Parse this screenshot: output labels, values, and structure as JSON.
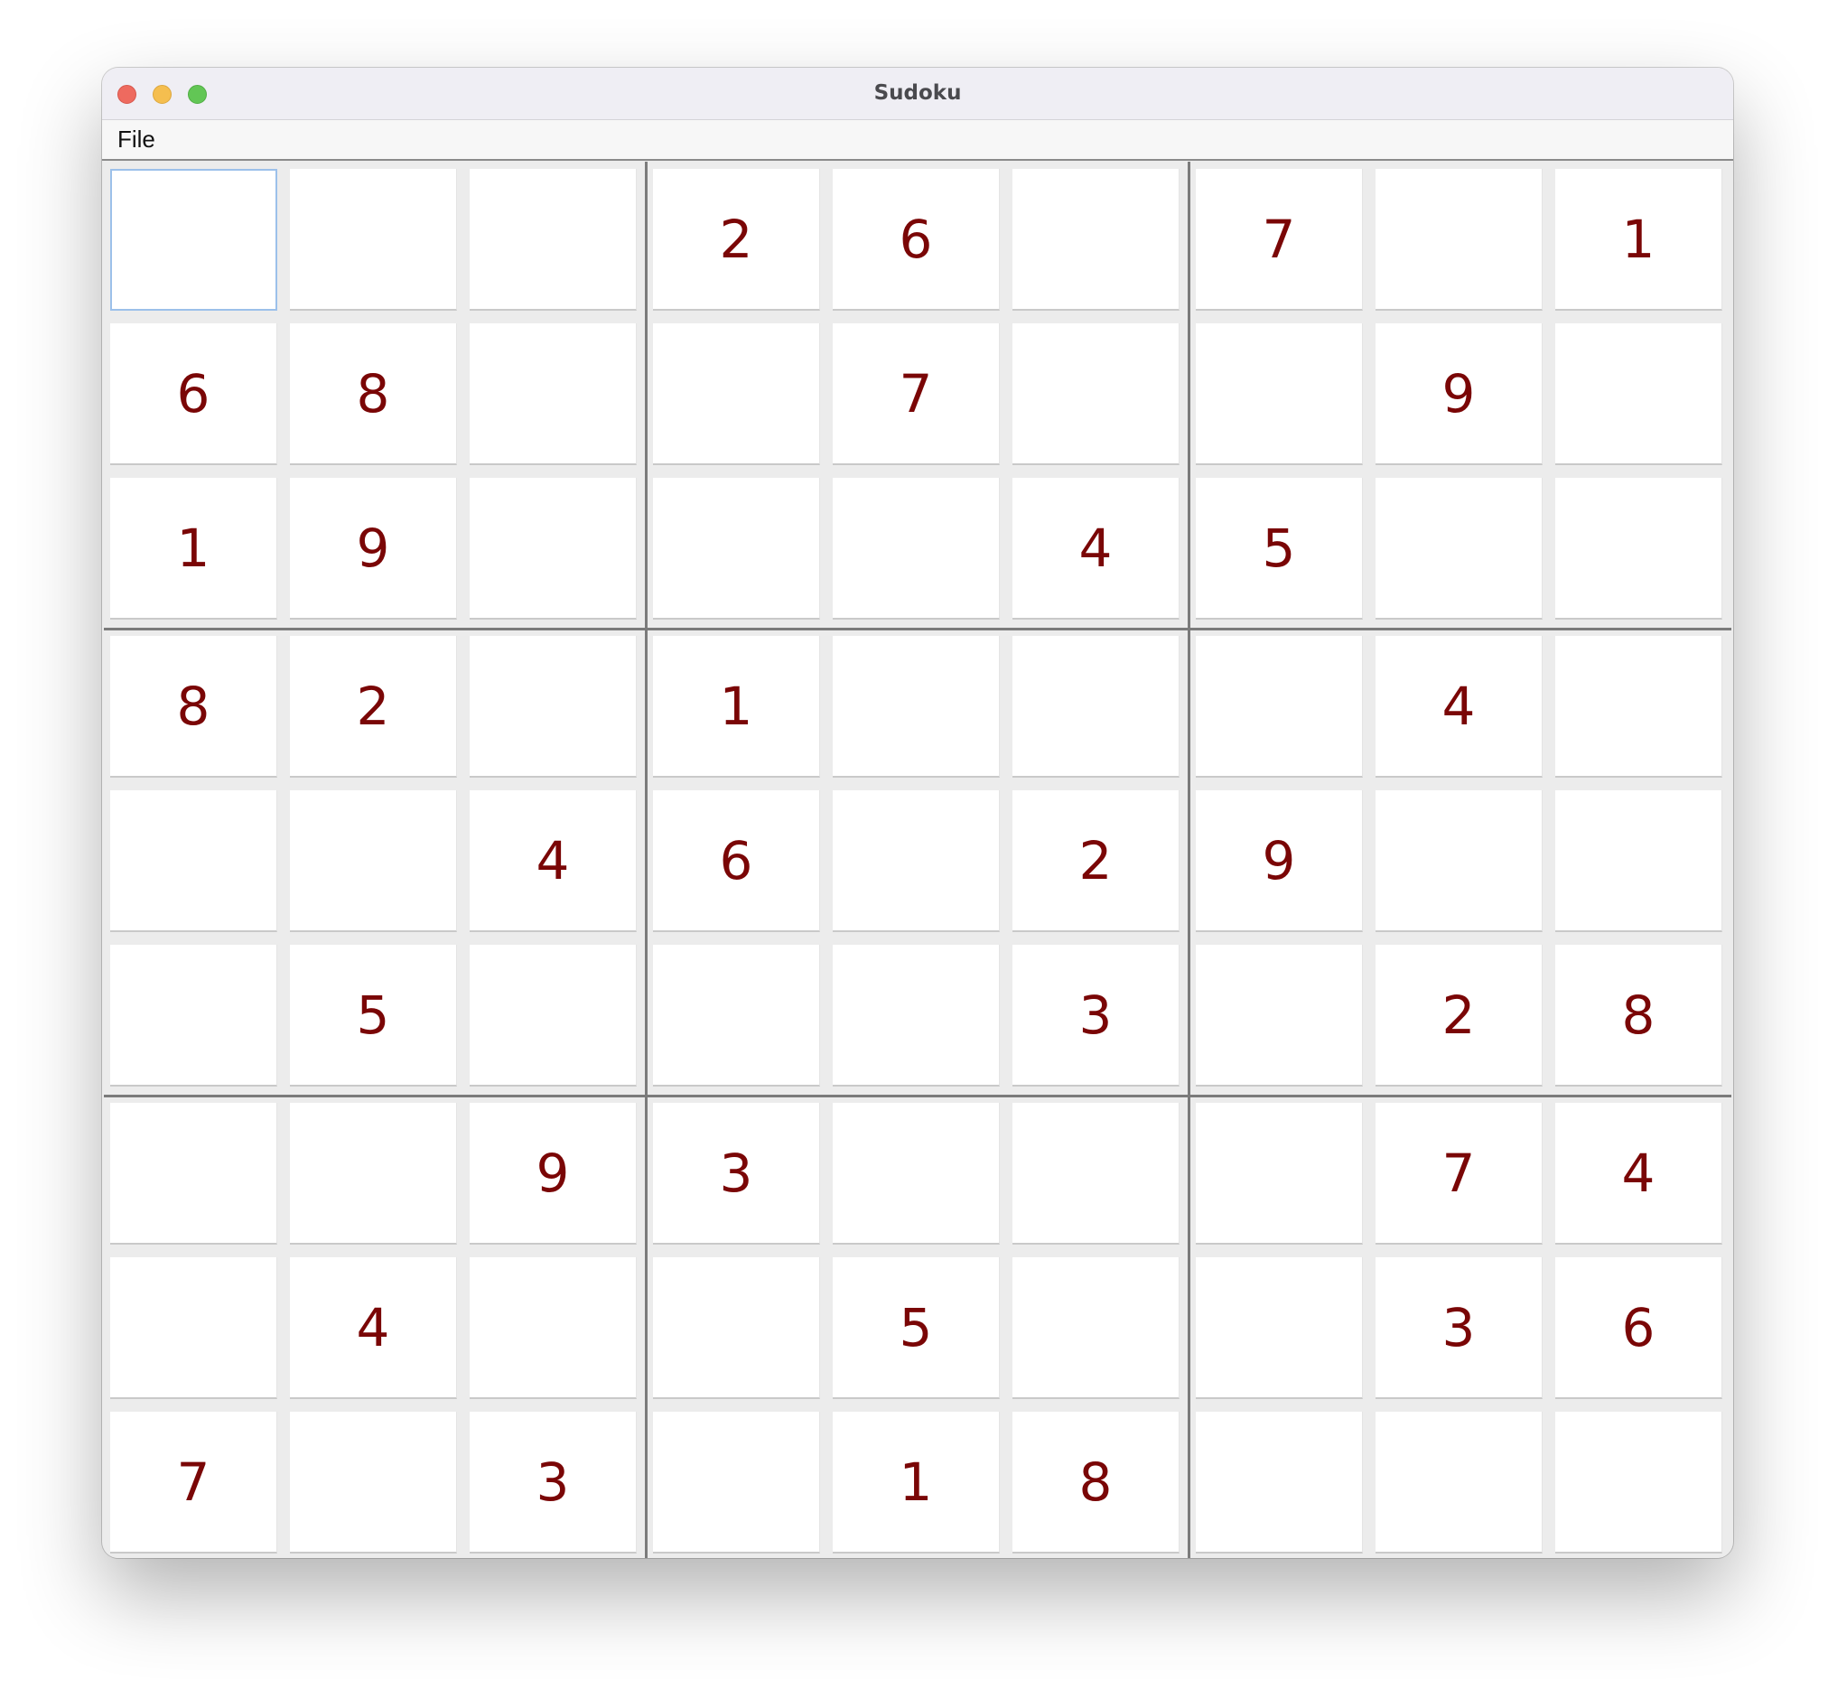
{
  "window": {
    "title": "Sudoku"
  },
  "menu": {
    "file_label": "File"
  },
  "board": {
    "selected_cell": [
      0,
      0
    ],
    "rows": [
      [
        "",
        "",
        "",
        "2",
        "6",
        "",
        "7",
        "",
        "1"
      ],
      [
        "6",
        "8",
        "",
        "",
        "7",
        "",
        "",
        "9",
        ""
      ],
      [
        "1",
        "9",
        "",
        "",
        "",
        "4",
        "5",
        "",
        ""
      ],
      [
        "8",
        "2",
        "",
        "1",
        "",
        "",
        "",
        "4",
        ""
      ],
      [
        "",
        "",
        "4",
        "6",
        "",
        "2",
        "9",
        "",
        ""
      ],
      [
        "",
        "5",
        "",
        "",
        "",
        "3",
        "",
        "2",
        "8"
      ],
      [
        "",
        "",
        "9",
        "3",
        "",
        "",
        "",
        "7",
        "4"
      ],
      [
        "",
        "4",
        "",
        "",
        "5",
        "",
        "",
        "3",
        "6"
      ],
      [
        "7",
        "",
        "3",
        "",
        "1",
        "8",
        "",
        "",
        ""
      ]
    ]
  },
  "colors": {
    "digit": "#7a0606",
    "cell_background": "#ffffff",
    "board_background": "#ececec",
    "block_divider": "#7b7b7b",
    "selection_border": "#9cc0ea"
  }
}
